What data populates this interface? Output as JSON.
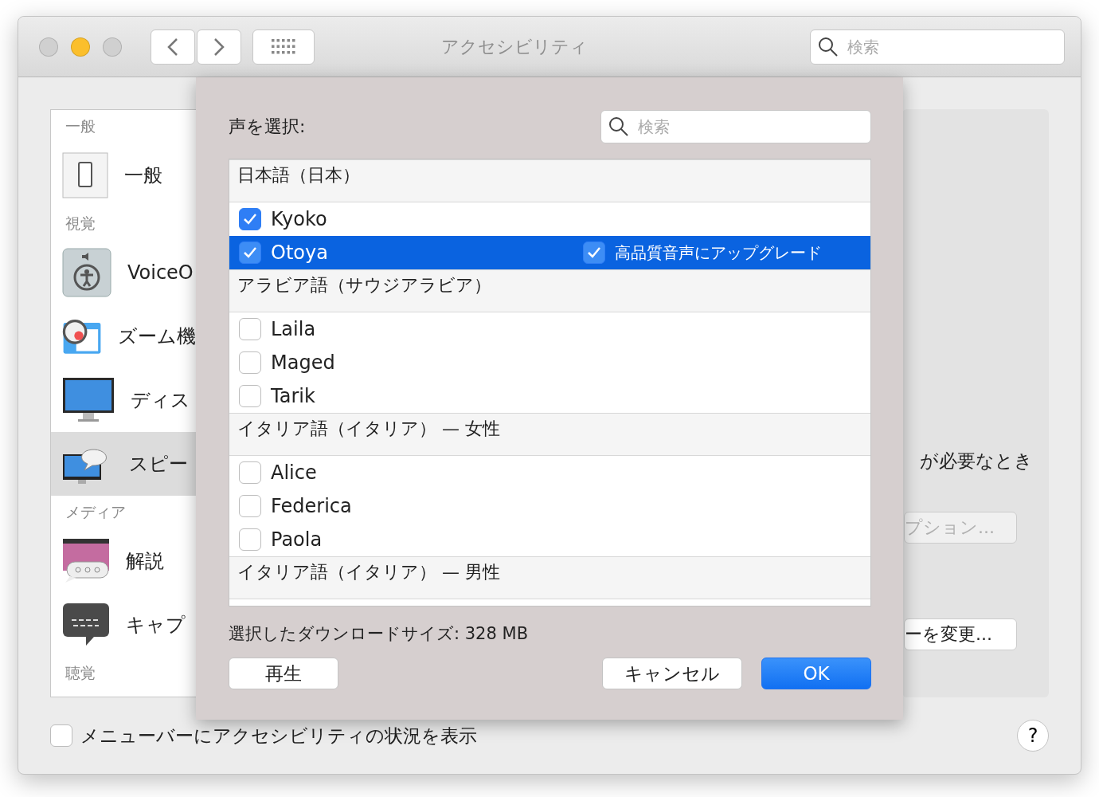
{
  "window": {
    "title": "アクセシビリティ",
    "search": {
      "placeholder": "検索"
    }
  },
  "sidebar": {
    "sections": [
      {
        "title": "一般",
        "items": [
          {
            "label": "一般",
            "selected": false
          }
        ]
      },
      {
        "title": "視覚",
        "items": [
          {
            "label": "VoiceO",
            "selected": false
          },
          {
            "label": "ズーム機",
            "selected": false
          },
          {
            "label": "ディス",
            "selected": false
          },
          {
            "label": "スピー",
            "selected": true
          }
        ]
      },
      {
        "title": "メディア",
        "items": [
          {
            "label": "解説",
            "selected": false
          },
          {
            "label": "キャプ",
            "selected": false
          }
        ]
      },
      {
        "title": "聴覚"
      }
    ]
  },
  "right_panel": {
    "text_1": "が必要なとき",
    "options_button": {
      "label": "プション...",
      "disabled": true
    },
    "change_button": {
      "label": "ーを変更...",
      "disabled": false
    }
  },
  "sheet": {
    "label": "声を選択:",
    "search": {
      "placeholder": "検索"
    },
    "voices": [
      {
        "kind": "header",
        "label": "日本語（日本）"
      },
      {
        "kind": "voice",
        "label": "Kyoko",
        "checked": true,
        "selected": false
      },
      {
        "kind": "voice",
        "label": "Otoya",
        "checked": true,
        "selected": true,
        "upgrade": {
          "label": "高品質音声にアップグレード",
          "checked": true
        }
      },
      {
        "kind": "header",
        "label": "アラビア語（サウジアラビア）"
      },
      {
        "kind": "voice",
        "label": "Laila",
        "checked": false,
        "selected": false
      },
      {
        "kind": "voice",
        "label": "Maged",
        "checked": false,
        "selected": false
      },
      {
        "kind": "voice",
        "label": "Tarik",
        "checked": false,
        "selected": false
      },
      {
        "kind": "header",
        "label": "イタリア語（イタリア） — 女性"
      },
      {
        "kind": "voice",
        "label": "Alice",
        "checked": false,
        "selected": false
      },
      {
        "kind": "voice",
        "label": "Federica",
        "checked": false,
        "selected": false
      },
      {
        "kind": "voice",
        "label": "Paola",
        "checked": false,
        "selected": false
      },
      {
        "kind": "header",
        "label": "イタリア語（イタリア） — 男性"
      }
    ],
    "download_size": "選択したダウンロードサイズ: 328 MB",
    "buttons": [
      {
        "label": "再生",
        "default": false
      },
      {
        "label": "キャンセル",
        "default": false
      },
      {
        "label": "OK",
        "default": true
      }
    ]
  },
  "footer": {
    "checkbox": {
      "label": "メニューバーにアクセシビリティの状況を表示",
      "checked": false
    },
    "help": "?"
  }
}
